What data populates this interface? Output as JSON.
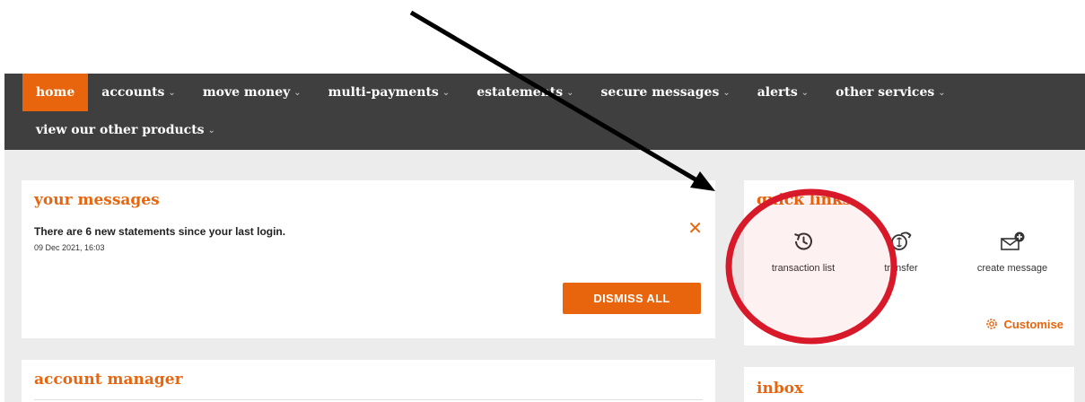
{
  "nav": {
    "row1": [
      {
        "label": "home",
        "chevron": false,
        "active": true
      },
      {
        "label": "accounts",
        "chevron": true
      },
      {
        "label": "move money",
        "chevron": true
      },
      {
        "label": "multi-payments",
        "chevron": true
      },
      {
        "label": "estatements",
        "chevron": true
      },
      {
        "label": "secure messages",
        "chevron": true
      },
      {
        "label": "alerts",
        "chevron": true
      },
      {
        "label": "other services",
        "chevron": true
      }
    ],
    "row2": [
      {
        "label": "view our other products",
        "chevron": true
      }
    ]
  },
  "messages": {
    "title": "your messages",
    "text": "There are 6 new statements since your last login.",
    "date": "09 Dec 2021, 16:03",
    "dismiss_label": "DISMISS ALL"
  },
  "account_manager": {
    "title": "account manager"
  },
  "quick_links": {
    "title": "quick links",
    "items": [
      {
        "label": "transaction list",
        "icon": "history-icon"
      },
      {
        "label": "transfer",
        "icon": "transfer-icon"
      },
      {
        "label": "create message",
        "icon": "new-message-icon"
      }
    ],
    "customise_label": "Customise"
  },
  "inbox": {
    "title": "inbox"
  },
  "colors": {
    "accent": "#e8650d",
    "nav_bg": "#3f3f3f",
    "content_bg": "#ececec",
    "annotation_circle": "#d8192a",
    "annotation_arrow": "#000000"
  }
}
